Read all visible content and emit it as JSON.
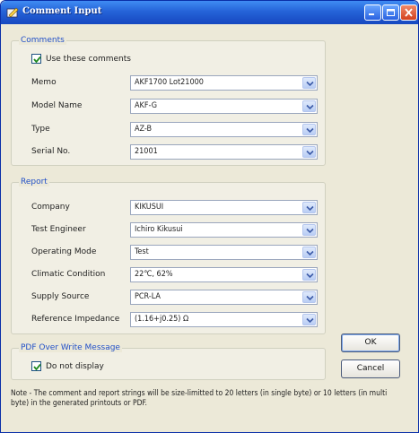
{
  "window": {
    "title": "Comment Input"
  },
  "comments": {
    "group_title": "Comments",
    "use_checkbox": {
      "label": "Use these comments",
      "checked": true
    },
    "fields": [
      {
        "label": "Memo",
        "value": "AKF1700 Lot21000"
      },
      {
        "label": "Model Name",
        "value": "AKF-G"
      },
      {
        "label": "Type",
        "value": "AZ-B"
      },
      {
        "label": "Serial No.",
        "value": "21001"
      }
    ]
  },
  "report": {
    "group_title": "Report",
    "fields": [
      {
        "label": "Company",
        "value": "KIKUSUI"
      },
      {
        "label": "Test Engineer",
        "value": "Ichiro Kikusui"
      },
      {
        "label": "Operating Mode",
        "value": "Test"
      },
      {
        "label": "Climatic Condition",
        "value": "22℃, 62%"
      },
      {
        "label": "Supply Source",
        "value": "PCR-LA"
      },
      {
        "label": "Reference Impedance",
        "value": "(1.16+j0.25) Ω"
      }
    ]
  },
  "pdf": {
    "group_title": "PDF Over Write Message",
    "checkbox": {
      "label": "Do not display",
      "checked": true
    }
  },
  "buttons": {
    "ok": "OK",
    "cancel": "Cancel"
  },
  "note": "Note - The comment and report strings will be size-limitted to 20 letters (in single byte) or 10 letters (in multi byte) in the generated printouts or PDF.",
  "colors": {
    "title_bar": "#2563d8",
    "group_title": "#2250c8",
    "window_bg": "#ece9d8"
  }
}
